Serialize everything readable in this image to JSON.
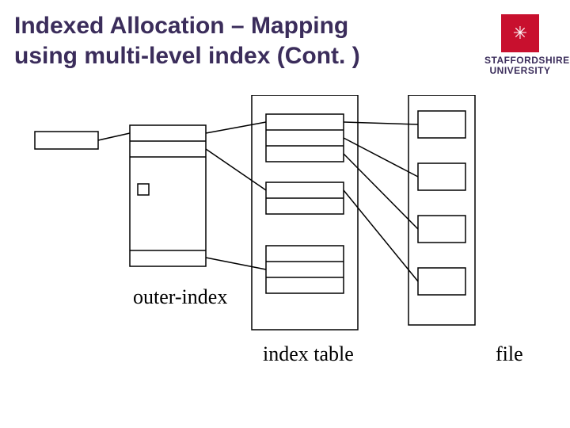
{
  "title_line1": "Indexed Allocation – Mapping",
  "title_line2": "using multi-level index (Cont. )",
  "labels": {
    "outer_index": "outer-index",
    "index_table": "index table",
    "file": "file"
  },
  "logo": {
    "glyph": "✳",
    "text_line1": "STAFFORDSHIRE",
    "text_line2": "UNIVERSITY"
  }
}
